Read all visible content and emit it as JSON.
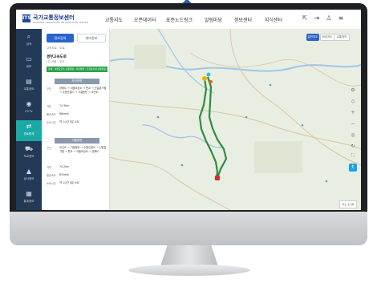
{
  "header": {
    "logo_mark": "ITS",
    "logo_text": "국가교통정보센터",
    "logo_sub": "NATIONAL TRANSPORT INFORMATION CENTER",
    "nav": [
      "교통지도",
      "오픈데이터",
      "표준노드링크",
      "알림마당",
      "정보센터",
      "지식센터"
    ],
    "icons": [
      "share-icon",
      "login-icon",
      "user-icon",
      "menu-icon"
    ]
  },
  "sidebar": {
    "items": [
      {
        "label": "검색",
        "icon": "search-icon"
      },
      {
        "label": "정보",
        "icon": "monitor-icon"
      },
      {
        "label": "교통정보",
        "icon": "bus-icon"
      },
      {
        "label": "CCTV",
        "icon": "cctv-icon"
      },
      {
        "label": "경로탐색",
        "icon": "route-icon"
      },
      {
        "label": "도로정보",
        "icon": "car-icon"
      },
      {
        "label": "공사정보",
        "icon": "cone-icon"
      },
      {
        "label": "통계정보",
        "icon": "stats-icon"
      }
    ]
  },
  "panel": {
    "tab_on": "정보검색",
    "tab_off": "테마정보",
    "crumb": "고속도로 · 도로",
    "route_title": "경부고속도로",
    "route_code": "(주)서울 - 부산",
    "green_bar": "양재 - 서울요금소 소통원활  /  서울방면 - 신갈분기점 소통원활 (시간)",
    "sec1": {
      "header": "부산방면",
      "rows": [
        {
          "label": "구간",
          "value": "양재IC → 서울요금소 → 판교 → 신갈분기점 → 수원신갈IC → 기흥동탄 → 오산IC"
        },
        {
          "label": "거리",
          "value": "74.3km"
        },
        {
          "label": "평균속도",
          "value": "86km/h"
        },
        {
          "label": "소요시간",
          "value": "약 1시간 5분 소요"
        }
      ]
    },
    "sec2": {
      "header": "서울방면",
      "rows": [
        {
          "label": "구간",
          "value": "오산IC → 기흥동탄 → 수원신갈IC → 신갈분기점 → 판교 → 서울요금소 → 양재IC"
        },
        {
          "label": "거리",
          "value": "74.2km"
        },
        {
          "label": "평균속도",
          "value": "87km/h"
        },
        {
          "label": "소요시간",
          "value": "약 1시간 4분 소요"
        }
      ]
    }
  },
  "map": {
    "buttons": {
      "b1": "일반지도",
      "b2": "위성지도",
      "b3": "교통정보"
    },
    "icons": [
      "settings-icon",
      "layers-icon",
      "zoom-in-icon",
      "zoom-out-icon",
      "locate-icon",
      "refresh-icon",
      "fullscreen-icon",
      "print-icon",
      "twitter-icon"
    ],
    "footer_btn": "지도 초기화",
    "route_color": "#2e8b3d",
    "water_color": "#9fc6e8"
  }
}
